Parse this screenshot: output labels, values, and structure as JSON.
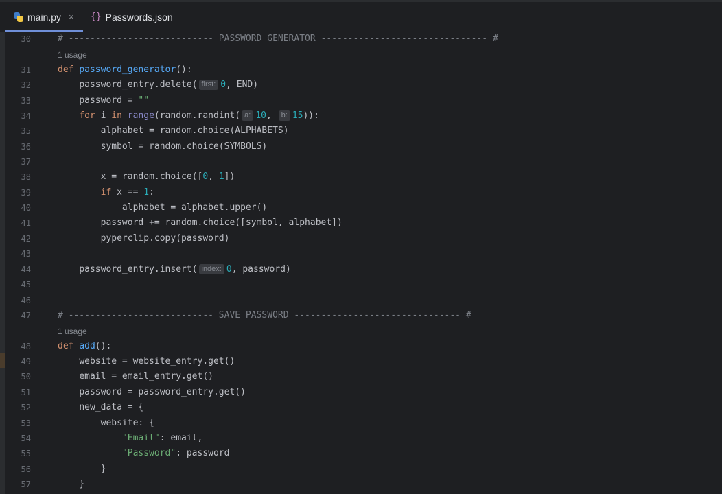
{
  "tabs": [
    {
      "label": "main.py",
      "icon": "python-file-icon",
      "active": true,
      "close": "×"
    },
    {
      "label": "Passwords.json",
      "icon": "json-file-icon",
      "active": false,
      "json_glyph": "{}"
    }
  ],
  "usage_label": "1 usage",
  "hints": {
    "first": "first:",
    "a": "a:",
    "b": "b:",
    "index": "index:"
  },
  "line_numbers": [
    "30",
    "31",
    "32",
    "33",
    "34",
    "35",
    "36",
    "37",
    "38",
    "39",
    "40",
    "41",
    "42",
    "43",
    "44",
    "45",
    "46",
    "47",
    "48",
    "49",
    "50",
    "51",
    "52",
    "53",
    "54",
    "55",
    "56",
    "57"
  ],
  "code": {
    "l30": "# --------------------------- PASSWORD GENERATOR ------------------------------- #",
    "l31_def": "def",
    "l31_fn": "password_generator",
    "l31_rest": "():",
    "l32_a": "password_entry.delete(",
    "l32_b": "0",
    "l32_c": ", END)",
    "l33_a": "password = ",
    "l33_b": "\"\"",
    "l34_kw": "for",
    "l34_a": " i ",
    "l34_in": "in",
    "l34_range": "range",
    "l34_b": "(random.randint(",
    "l34_n1": "10",
    "l34_c": ", ",
    "l34_n2": "15",
    "l34_d": ")):",
    "l35": "alphabet = random.choice(ALPHABETS)",
    "l36": "symbol = random.choice(SYMBOLS)",
    "l38_a": "x = random.choice([",
    "l38_n1": "0",
    "l38_b": ", ",
    "l38_n2": "1",
    "l38_c": "])",
    "l39_kw": "if",
    "l39_a": " x == ",
    "l39_n": "1",
    "l39_b": ":",
    "l40": "alphabet = alphabet.upper()",
    "l41": "password += random.choice([symbol, alphabet])",
    "l42": "pyperclip.copy(password)",
    "l44_a": "password_entry.insert(",
    "l44_n": "0",
    "l44_b": ", password)",
    "l47": "# --------------------------- SAVE PASSWORD ------------------------------- #",
    "l48_def": "def",
    "l48_fn": "add",
    "l48_rest": "():",
    "l49": "website = website_entry.get()",
    "l50": "email = email_entry.get()",
    "l51": "password = password_entry.get()",
    "l52": "new_data = {",
    "l53": "website: {",
    "l54_s": "\"Email\"",
    "l54_r": ": email,",
    "l55_s": "\"Password\"",
    "l55_r": ": password",
    "l56": "}",
    "l57": "}"
  }
}
